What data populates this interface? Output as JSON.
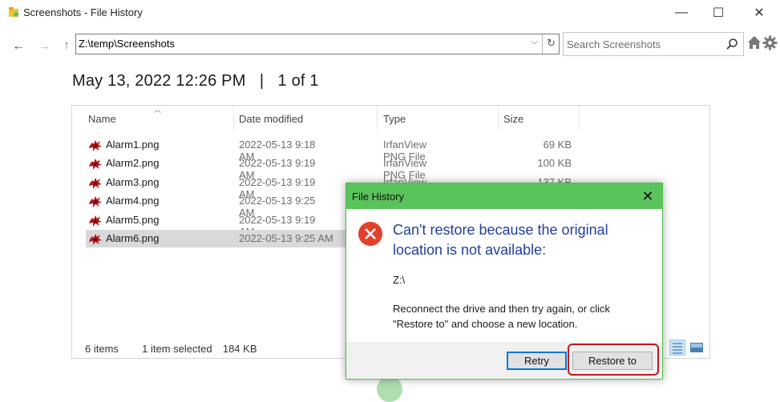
{
  "window": {
    "title": "Screenshots - File History",
    "minimize_glyph": "—",
    "maximize_glyph": "☐",
    "close_glyph": "✕"
  },
  "nav": {
    "back_glyph": "←",
    "forward_glyph": "→",
    "up_glyph": "↑",
    "address": "Z:\\temp\\Screenshots",
    "dropdown_glyph": "⌵",
    "refresh_glyph": "↻",
    "search_placeholder": "Search Screenshots",
    "search_glyph": "⚲"
  },
  "heading": "May 13, 2022 12:26 PM   |   1 of 1",
  "columns": {
    "name": "Name",
    "date": "Date modified",
    "type": "Type",
    "size": "Size"
  },
  "files": [
    {
      "name": "Alarm1.png",
      "date": "2022-05-13 9:18 AM",
      "type": "IrfanView PNG File",
      "size": "69 KB"
    },
    {
      "name": "Alarm2.png",
      "date": "2022-05-13 9:19 AM",
      "type": "IrfanView PNG File",
      "size": "100 KB"
    },
    {
      "name": "Alarm3.png",
      "date": "2022-05-13 9:19 AM",
      "type": "IrfanView PNG File",
      "size": "137 KB"
    },
    {
      "name": "Alarm4.png",
      "date": "2022-05-13 9:25 AM",
      "type": "",
      "size": ""
    },
    {
      "name": "Alarm5.png",
      "date": "2022-05-13 9:19 AM",
      "type": "",
      "size": ""
    },
    {
      "name": "Alarm6.png",
      "date": "2022-05-13 9:25 AM",
      "type": "",
      "size": "",
      "selected": true
    }
  ],
  "status": {
    "items": "6 items",
    "selected": "1 item selected",
    "size": "184 KB"
  },
  "dialog": {
    "title": "File History",
    "close_glyph": "✕",
    "heading": "Can't restore because the original location is not available:",
    "path": "Z:\\",
    "message": "Reconnect the drive and then try again, or click \"Restore to\" and choose a new location.",
    "retry_label": "Retry",
    "restore_label": "Restore to"
  },
  "icons": {
    "app": "file-history-icon",
    "file": "irfanview-png-icon",
    "error": "error-icon",
    "home": "home-icon",
    "settings": "gear-icon"
  },
  "colors": {
    "dialog_title_bg": "#5bc35b",
    "dialog_heading": "#1f3f9e",
    "error_red": "#e3402a",
    "highlight_red": "#c0181d",
    "selection_gray": "#d9d9d9"
  }
}
